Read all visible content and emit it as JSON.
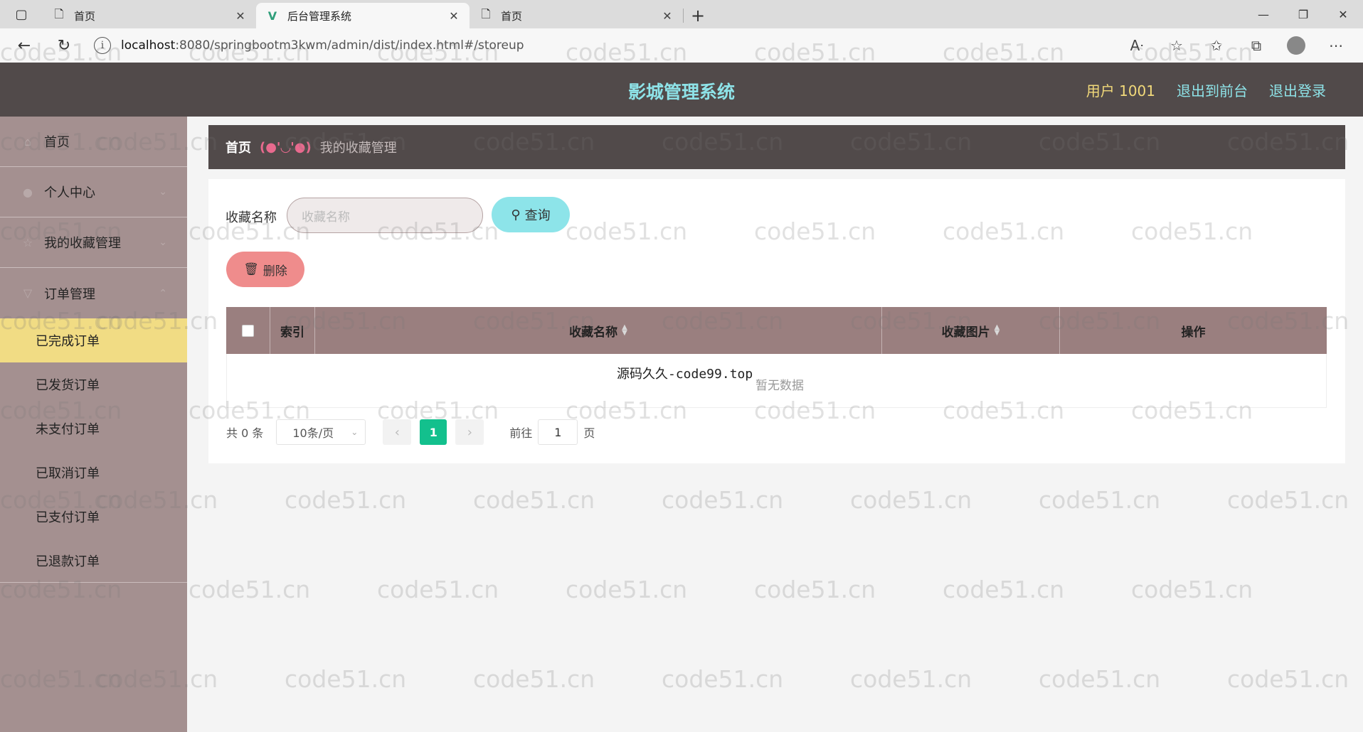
{
  "browser": {
    "tabs": [
      {
        "title": "首页",
        "active": false
      },
      {
        "title": "后台管理系统",
        "active": true
      },
      {
        "title": "首页",
        "active": false
      }
    ],
    "url_host": "localhost",
    "url_rest": ":8080/springbootm3kwm/admin/dist/index.html#/storeup"
  },
  "header": {
    "title": "影城管理系统",
    "user": "用户 1001",
    "to_front": "退出到前台",
    "logout": "退出登录"
  },
  "sidebar": {
    "items": [
      {
        "label": "首页",
        "icon": "home-icon"
      },
      {
        "label": "个人中心",
        "icon": "user-icon"
      },
      {
        "label": "我的收藏管理",
        "icon": "star-icon"
      },
      {
        "label": "订单管理",
        "icon": "cart-icon"
      }
    ],
    "submenu": [
      {
        "label": "已完成订单",
        "active": true
      },
      {
        "label": "已发货订单"
      },
      {
        "label": "未支付订单"
      },
      {
        "label": "已取消订单"
      },
      {
        "label": "已支付订单"
      },
      {
        "label": "已退款订单"
      }
    ]
  },
  "breadcrumb": {
    "home": "首页",
    "separator": "(●'◡'●)",
    "current": "我的收藏管理"
  },
  "search": {
    "label": "收藏名称",
    "placeholder": "收藏名称",
    "query_button": "查询"
  },
  "actions": {
    "delete_button": "删除"
  },
  "table": {
    "columns": [
      "索引",
      "收藏名称",
      "收藏图片",
      "操作"
    ],
    "empty_text": "暂无数据",
    "overlay_text": "源码久久-code99.top"
  },
  "pagination": {
    "total": "共 0 条",
    "page_size": "10条/页",
    "current_page": "1",
    "goto_label": "前往",
    "goto_value": "1",
    "page_suffix": "页"
  },
  "watermark": "code51.cn",
  "colors": {
    "header_bg": "#514a4a",
    "sidebar_bg": "#a49090",
    "accent_cyan": "#8ee3e8",
    "active_yellow": "#f1dc84",
    "delete_red": "#ef8c8c",
    "page_green": "#13c08d"
  }
}
